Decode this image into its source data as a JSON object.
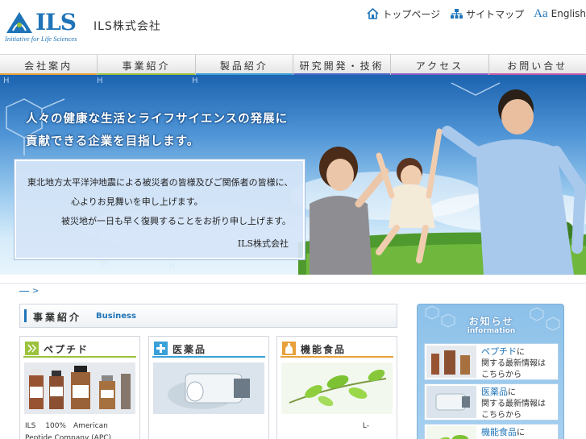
{
  "header": {
    "logo_text": "ILS",
    "logo_sub": "Initiative for Life Sciences",
    "company_name": "ILS株式会社",
    "links": {
      "top": "トップページ",
      "sitemap": "サイトマップ",
      "english_prefix": "Aa",
      "english": "English"
    }
  },
  "nav": {
    "items": [
      {
        "label": "会社案内",
        "color": "#e8a13a"
      },
      {
        "label": "事業紹介",
        "color": "#9bc23c"
      },
      {
        "label": "製品紹介",
        "color": "#3aa0d8"
      },
      {
        "label": "研究開発・技術",
        "color": "#4f68c8"
      },
      {
        "label": "アクセス",
        "color": "#8a5cc5"
      },
      {
        "label": "お問い合せ",
        "color": "#c45aa8"
      }
    ]
  },
  "hero": {
    "tagline_1": "人々の健康な生活とライフサイエンスの発展に",
    "tagline_2": "貢献できる企業を目指します。",
    "notice": {
      "line_1": "東北地方太平洋沖地震による被災者の皆様及びご関係者の皆様に、",
      "line_2": "心よりお見舞いを申し上げます。",
      "line_3": "被災地が一日も早く復興することをお祈り申し上げます。",
      "signature": "ILS株式会社"
    }
  },
  "breadcrumb": {
    "sep": ">"
  },
  "business": {
    "title_jp": "事業紹介",
    "title_en": "Business",
    "cards": [
      {
        "title": "ペプチド",
        "icon": "peptide-icon",
        "color": "#9bc23c",
        "text": "ILS　 100%　American Peptide Company (APC)"
      },
      {
        "title": "医薬品",
        "icon": "cross-icon",
        "color": "#3aa0d8",
        "text": ""
      },
      {
        "title": "機能食品",
        "icon": "bottle-icon",
        "color": "#e8a13a",
        "text": "L-"
      }
    ]
  },
  "news": {
    "title": "お知らせ",
    "subtitle": "information",
    "items": [
      {
        "highlight": "ペプチド",
        "suffix": "に",
        "line2": "関する最新情報は",
        "line3": "こちらから"
      },
      {
        "highlight": "医薬品",
        "suffix": "に",
        "line2": "関する最新情報は",
        "line3": "こちらから"
      },
      {
        "highlight": "機能食品",
        "suffix": "に",
        "line2": "",
        "line3": ""
      }
    ]
  }
}
